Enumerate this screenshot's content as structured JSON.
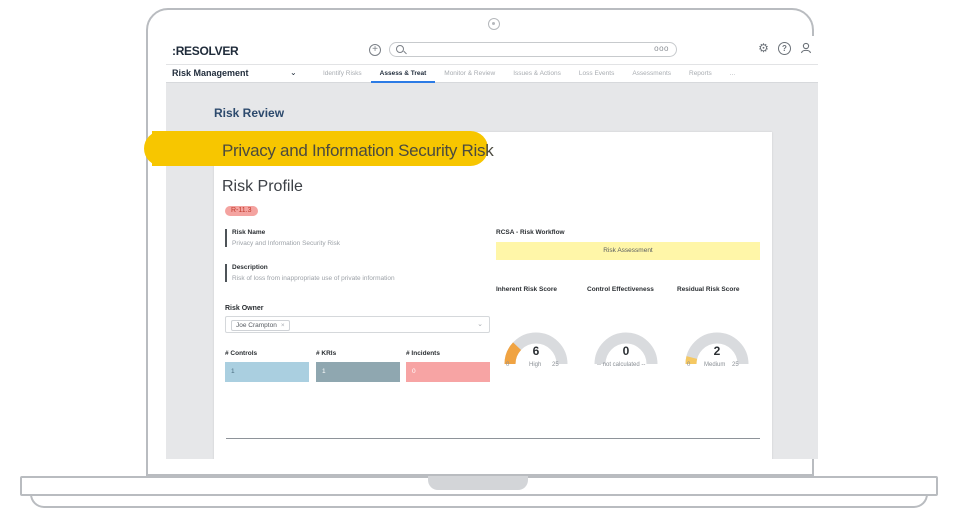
{
  "app": {
    "logo": ":RESOLVER",
    "search_more": "ooo",
    "top_icons": [
      "add-icon",
      "search-icon",
      "gear-icon",
      "help-icon",
      "user-icon"
    ]
  },
  "nav": {
    "app_name": "Risk Management",
    "tabs": [
      {
        "label": "Identify Risks",
        "active": false
      },
      {
        "label": "Assess & Treat",
        "active": true
      },
      {
        "label": "Monitor & Review",
        "active": false
      },
      {
        "label": "Issues & Actions",
        "active": false
      },
      {
        "label": "Loss Events",
        "active": false
      },
      {
        "label": "Assessments",
        "active": false
      },
      {
        "label": "Reports",
        "active": false
      },
      {
        "label": "...",
        "active": false
      }
    ]
  },
  "page": {
    "title": "Risk Review",
    "record_title": "Privacy and Information Security Risk",
    "profile_title": "Risk Profile",
    "badge": "R-11.3"
  },
  "fields": {
    "risk_name_label": "Risk Name",
    "risk_name_value": "Privacy and Information Security Risk",
    "description_label": "Description",
    "description_value": "Risk of loss from inappropriate use of private information",
    "risk_owner_label": "Risk Owner",
    "risk_owner_value": "Joe Crampton",
    "risk_owner_remove": "×"
  },
  "counts": {
    "controls_label": "# Controls",
    "controls_value": "1",
    "kris_label": "# KRIs",
    "kris_value": "1",
    "incidents_label": "# Incidents",
    "incidents_value": "0"
  },
  "workflow": {
    "label": "RCSA - Risk Workflow",
    "state": "Risk Assessment"
  },
  "scores": {
    "inherent": {
      "label": "Inherent Risk Score",
      "value": "6",
      "rating": "High",
      "min": "0",
      "max": "25",
      "fill_fraction": 0.24,
      "color": "#f0a342"
    },
    "control": {
      "label": "Control Effectiveness",
      "value": "0",
      "rating": "-- not calculated --",
      "min": "",
      "max": "",
      "fill_fraction": 0,
      "color": "#cfd1d4"
    },
    "residual": {
      "label": "Residual Risk Score",
      "value": "2",
      "rating": "Medium",
      "min": "0",
      "max": "25",
      "fill_fraction": 0.08,
      "color": "#f5c862"
    }
  },
  "colors": {
    "highlight": "#f7c600",
    "controls_box": "#aacfe0",
    "kris_box": "#8fa7b0",
    "incidents_box": "#f7a4a4",
    "gauge_track": "#d9dbde",
    "active_tab": "#2c7be5"
  }
}
